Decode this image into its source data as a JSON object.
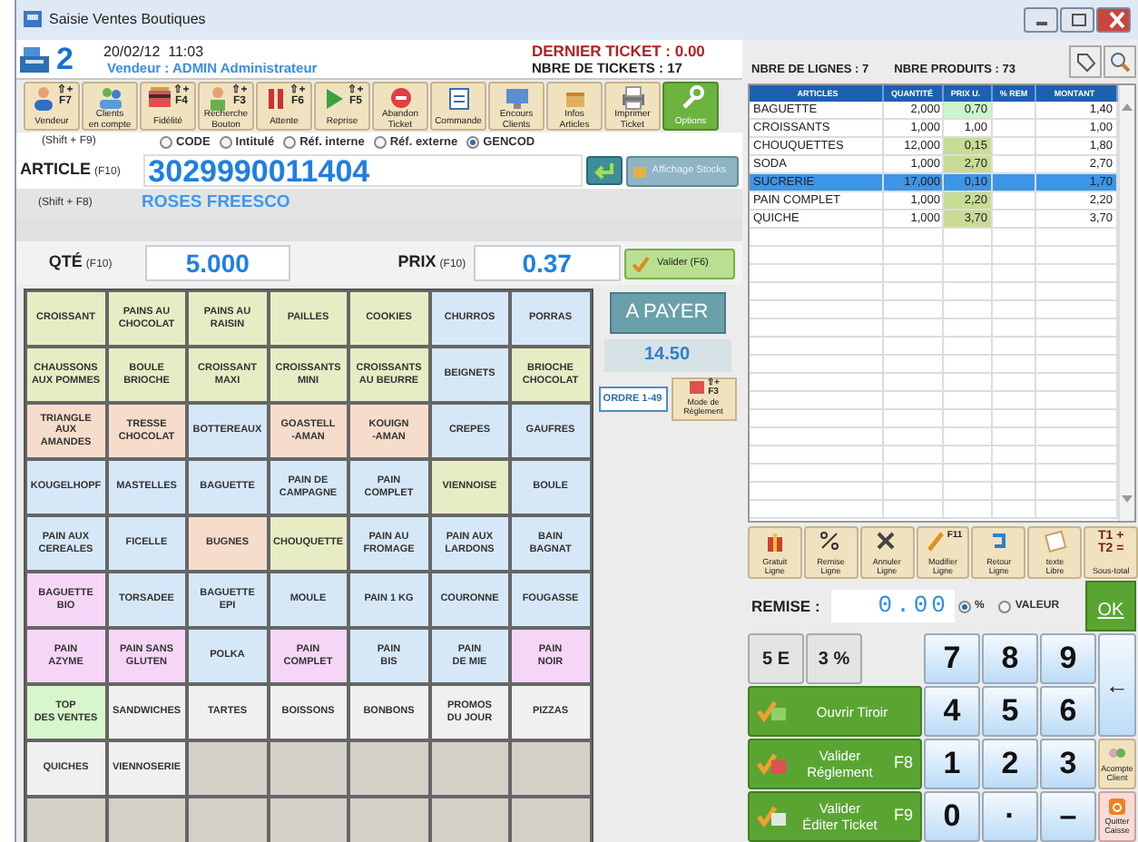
{
  "window": {
    "title": "Saisie Ventes Boutiques"
  },
  "header": {
    "register": "2",
    "datetime": "20/02/12  11:03",
    "vendor": "Vendeur : ADMIN Administrateur",
    "last_ticket": "DERNIER TICKET : 0.00",
    "ticket_count": "NBRE DE TICKETS : 17"
  },
  "toolbar": [
    {
      "label": "Vendeur",
      "key_mod": "⇧+",
      "key": "F7",
      "selected": false
    },
    {
      "label": "Clients\nen compte",
      "selected": false
    },
    {
      "label": "Fidélité",
      "key_mod": "⇧+",
      "key": "F4",
      "selected": false
    },
    {
      "label": "Recherche\nBouton",
      "key_mod": "⇧+",
      "key": "F3",
      "selected": false
    },
    {
      "label": "Attente",
      "key_mod": "⇧+",
      "key": "F6",
      "selected": false
    },
    {
      "label": "Reprise",
      "key_mod": "⇧+",
      "key": "F5",
      "selected": false
    },
    {
      "label": "Abandon\nTicket",
      "selected": false
    },
    {
      "label": "Commande",
      "selected": false
    },
    {
      "label": "Encours\nClients",
      "selected": false
    },
    {
      "label": "Infos\nArticles",
      "selected": false
    },
    {
      "label": "Imprimer\nTicket",
      "selected": false
    },
    {
      "label": "Options",
      "selected": true
    }
  ],
  "search_modes": {
    "shortcut": "(Shift + F9)",
    "options": [
      {
        "label": "CODE",
        "selected": false
      },
      {
        "label": "Intitulé",
        "selected": false
      },
      {
        "label": "Réf. interne",
        "selected": false
      },
      {
        "label": "Réf. externe",
        "selected": false
      },
      {
        "label": "GENCOD",
        "selected": true
      }
    ]
  },
  "article": {
    "label": "ARTICLE",
    "key": "(F10)",
    "value": "3029990011404",
    "stock_button": "Affichage Stocks"
  },
  "designation": {
    "shortcut": "(Shift + F8)",
    "value": "ROSES FREESCO"
  },
  "quantity": {
    "label": "QTÉ",
    "key": "(F10)",
    "value": "5.000"
  },
  "price": {
    "label": "PRIX",
    "key": "(F10)",
    "value": "0.37"
  },
  "validate_button": "Valider (F6)",
  "products": [
    {
      "label": "CROISSANT",
      "color": "#e8ecc4"
    },
    {
      "label": "PAINS AU\nCHOCOLAT",
      "color": "#e8ecc4"
    },
    {
      "label": "PAINS AU\nRAISIN",
      "color": "#e8ecc4"
    },
    {
      "label": "PAILLES",
      "color": "#e8ecc4"
    },
    {
      "label": "COOKIES",
      "color": "#e8ecc4"
    },
    {
      "label": "CHURROS",
      "color": "#d6e8f8"
    },
    {
      "label": "PORRAS",
      "color": "#d6e8f8"
    },
    {
      "label": "CHAUSSONS\nAUX POMMES",
      "color": "#e8ecc4"
    },
    {
      "label": "BOULE\nBRIOCHE",
      "color": "#e8ecc4"
    },
    {
      "label": "CROISSANT\nMAXI",
      "color": "#e8ecc4"
    },
    {
      "label": "CROISSANTS\nMINI",
      "color": "#e8ecc4"
    },
    {
      "label": "CROISSANTS\nAU BEURRE",
      "color": "#e8ecc4"
    },
    {
      "label": "BEIGNETS",
      "color": "#d6e8f8"
    },
    {
      "label": "BRIOCHE\nCHOCOLAT",
      "color": "#e8ecc4"
    },
    {
      "label": "TRIANGLE\nAUX\nAMANDES",
      "color": "#f6dccb"
    },
    {
      "label": "TRESSE\nCHOCOLAT",
      "color": "#f6dccb"
    },
    {
      "label": "BOTTEREAUX",
      "color": "#d6e8f8"
    },
    {
      "label": "GOASTELL\n-AMAN",
      "color": "#f6dccb"
    },
    {
      "label": "KOUIGN\n-AMAN",
      "color": "#f6dccb"
    },
    {
      "label": "CREPES",
      "color": "#d6e8f8"
    },
    {
      "label": "GAUFRES",
      "color": "#d6e8f8"
    },
    {
      "label": "KOUGELHOPF",
      "color": "#d6e8f8"
    },
    {
      "label": "MASTELLES",
      "color": "#d6e8f8"
    },
    {
      "label": "BAGUETTE",
      "color": "#d6e8f8"
    },
    {
      "label": "PAIN DE\nCAMPAGNE",
      "color": "#d6e8f8"
    },
    {
      "label": "PAIN\nCOMPLET",
      "color": "#d6e8f8"
    },
    {
      "label": "VIENNOISE",
      "color": "#e8ecc4"
    },
    {
      "label": "BOULE",
      "color": "#d6e8f8"
    },
    {
      "label": "PAIN AUX\nCEREALES",
      "color": "#d6e8f8"
    },
    {
      "label": "FICELLE",
      "color": "#d6e8f8"
    },
    {
      "label": "BUGNES",
      "color": "#f6dccb"
    },
    {
      "label": "CHOUQUETTE",
      "color": "#e8ecc4"
    },
    {
      "label": "PAIN AU\nFROMAGE",
      "color": "#d6e8f8"
    },
    {
      "label": "PAIN AUX\nLARDONS",
      "color": "#d6e8f8"
    },
    {
      "label": "BAIN\nBAGNAT",
      "color": "#d6e8f8"
    },
    {
      "label": "BAGUETTE\nBIO",
      "color": "#f6d6f6"
    },
    {
      "label": "TORSADEE",
      "color": "#d6e8f8"
    },
    {
      "label": "BAGUETTE\nEPI",
      "color": "#d6e8f8"
    },
    {
      "label": "MOULE",
      "color": "#d6e8f8"
    },
    {
      "label": "PAIN 1 KG",
      "color": "#d6e8f8"
    },
    {
      "label": "COURONNE",
      "color": "#d6e8f8"
    },
    {
      "label": "FOUGASSE",
      "color": "#d6e8f8"
    },
    {
      "label": "PAIN\nAZYME",
      "color": "#f6d6f6"
    },
    {
      "label": "PAIN SANS\nGLUTEN",
      "color": "#f6d6f6"
    },
    {
      "label": "POLKA",
      "color": "#d6e8f8"
    },
    {
      "label": "PAIN\nCOMPLET",
      "color": "#f6d6f6"
    },
    {
      "label": "PAIN\nBIS",
      "color": "#d6e8f8"
    },
    {
      "label": "PAIN\nDE MIE",
      "color": "#d6e8f8"
    },
    {
      "label": "PAIN\nNOIR",
      "color": "#f6d6f6"
    },
    {
      "label": "TOP\nDES VENTES",
      "color": "#d8f6cc"
    },
    {
      "label": "SANDWICHES",
      "color": "#f0f0f0"
    },
    {
      "label": "TARTES",
      "color": "#f0f0f0"
    },
    {
      "label": "BOISSONS",
      "color": "#f0f0f0"
    },
    {
      "label": "BONBONS",
      "color": "#f0f0f0"
    },
    {
      "label": "PROMOS\nDU JOUR",
      "color": "#f0f0f0"
    },
    {
      "label": "PIZZAS",
      "color": "#f0f0f0"
    },
    {
      "label": "QUICHES",
      "color": "#f0f0f0"
    },
    {
      "label": "VIENNOSERIE",
      "color": "#f0f0f0"
    }
  ],
  "payment": {
    "button": "A PAYER",
    "total": "14.50",
    "order_button": "ORDRE 1-49",
    "mode_key_mod": "⇧+",
    "mode_key": "F3",
    "mode_label": "Mode de\nRèglement"
  },
  "summary": {
    "lines": "NBRE DE LIGNES : 7",
    "products": "NBRE PRODUITS : 73"
  },
  "ticket": {
    "columns": [
      "ARTICLES",
      "QUANTITÉ",
      "PRIX U.",
      "% REM",
      "MONTANT"
    ],
    "rows": [
      {
        "cells": [
          "BAGUETTE",
          "2,000",
          "0,70",
          "",
          "1,40"
        ],
        "selected": false,
        "color": "#ccf5cc"
      },
      {
        "cells": [
          "CROISSANTS",
          "1,000",
          "1,00",
          "",
          "1,00"
        ],
        "selected": false,
        "color": "#ffffff"
      },
      {
        "cells": [
          "CHOUQUETTES",
          "12,000",
          "0,15",
          "",
          "1,80"
        ],
        "selected": false,
        "color": "#c8dc96"
      },
      {
        "cells": [
          "SODA",
          "1,000",
          "2,70",
          "",
          "2,70"
        ],
        "selected": false,
        "color": "#c8dc96"
      },
      {
        "cells": [
          "SUCRERIE",
          "17,000",
          "0,10",
          "",
          "1,70"
        ],
        "selected": true
      },
      {
        "cells": [
          "PAIN COMPLET",
          "1,000",
          "2,20",
          "",
          "2,20"
        ],
        "selected": false,
        "color": "#c8dc96"
      },
      {
        "cells": [
          "QUICHE",
          "1,000",
          "3,70",
          "",
          "3,70"
        ],
        "selected": false,
        "color": "#c8dc96"
      }
    ]
  },
  "line_actions": [
    {
      "label": "Gratuit\nLigne"
    },
    {
      "label": "Remise\nLigne"
    },
    {
      "label": "Annuler\nLigne"
    },
    {
      "label": "Modifier\nLigne",
      "key": "F11"
    },
    {
      "label": "Retour\nLigne"
    },
    {
      "label": "texte\nLibre"
    },
    {
      "label": "Sous-total",
      "icon_text": "T1 +\nT2 ="
    }
  ],
  "discount": {
    "label": "REMISE :",
    "value": "0.00",
    "modes": [
      {
        "label": "%",
        "selected": true
      },
      {
        "label": "VALEUR",
        "selected": false
      }
    ],
    "ok_button": "OK"
  },
  "presets": [
    "5 E",
    "3 %"
  ],
  "keys": [
    "7",
    "8",
    "9",
    "4",
    "5",
    "6",
    "1",
    "2",
    "3",
    "0",
    "·",
    "–"
  ],
  "backspace": "←",
  "actions": [
    {
      "label": "Ouvrir Tiroir"
    },
    {
      "label": "Valider\nRéglement",
      "key": "F8"
    },
    {
      "label": "Valider\nÉditer Ticket",
      "key": "F9"
    }
  ],
  "side_buttons": [
    {
      "label": "Acompte\nClient"
    },
    {
      "label": "Quitter\nCaisse"
    }
  ]
}
